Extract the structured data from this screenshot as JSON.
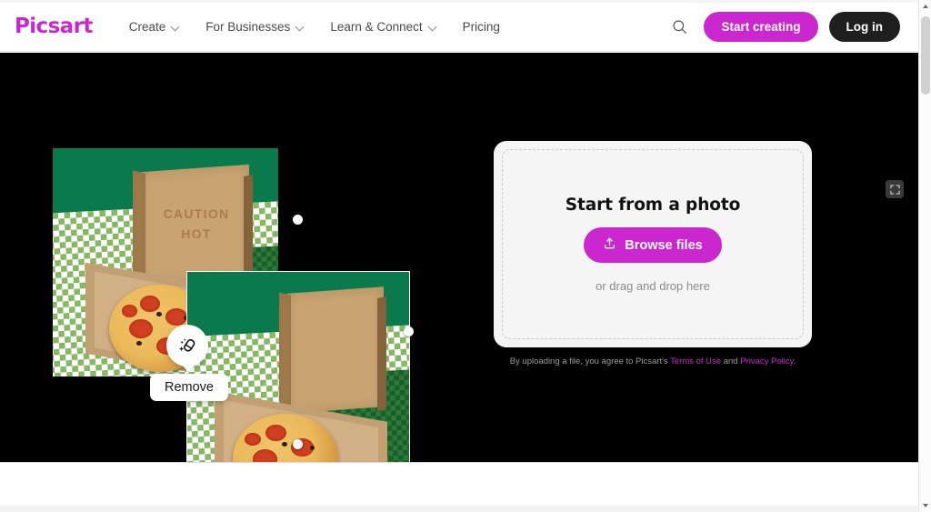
{
  "header": {
    "logo_text": "Picsart",
    "nav_items": [
      {
        "label": "Create",
        "has_chevron": true
      },
      {
        "label": "For Businesses",
        "has_chevron": true
      },
      {
        "label": "Learn & Connect",
        "has_chevron": true
      },
      {
        "label": "Pricing",
        "has_chevron": false
      }
    ],
    "search_icon": "search-icon",
    "start_creating_label": "Start creating",
    "login_label": "Log in"
  },
  "canvas": {
    "background_color": "#000000",
    "original_photo": {
      "alt": "Open cardboard pizza box with CAUTION HOT printed on lid, pepperoni pizza inside, on green gingham tablecloth",
      "caution_text": "CAUTION\nHOT"
    },
    "selected_photo": {
      "alt": "Same pizza box photo with the CAUTION HOT text removed",
      "selected": true,
      "handles": [
        "top-center",
        "right-center",
        "bottom-center"
      ]
    },
    "remove_tool": {
      "icon": "magic-eraser-icon",
      "label": "Remove"
    },
    "expand_button": {
      "icon": "expand-icon"
    }
  },
  "upload": {
    "title": "Start from a photo",
    "browse_label": "Browse files",
    "browse_icon": "upload-icon",
    "drag_text": "or drag and drop here",
    "accent_color": "#cb27ce",
    "legal": {
      "prefix": "By uploading a file, you agree to Picsart's ",
      "terms_label": "Terms of Use",
      "middle": " and ",
      "privacy_label": "Privacy Policy",
      "suffix": "."
    }
  },
  "scrollbar": {
    "up_icon": "scroll-up-arrow",
    "down_icon": "scroll-down-arrow",
    "thumb": "scroll-thumb"
  }
}
